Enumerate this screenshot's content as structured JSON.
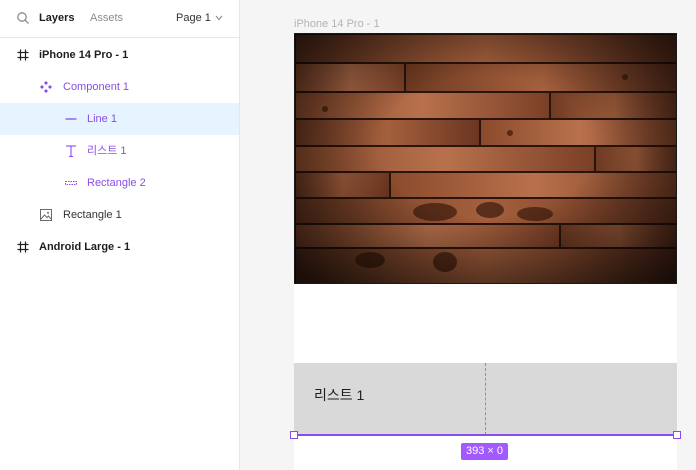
{
  "sidebar": {
    "tabs": {
      "layers": "Layers",
      "assets": "Assets"
    },
    "page": "Page 1",
    "layers": [
      {
        "label": "iPhone 14 Pro - 1",
        "icon": "frame-icon",
        "indent": 0,
        "style": "bold"
      },
      {
        "label": "Component 1",
        "icon": "component-icon",
        "indent": 1,
        "style": "purple"
      },
      {
        "label": "Line 1",
        "icon": "line-icon",
        "indent": 2,
        "style": "purple",
        "selected": true
      },
      {
        "label": "리스트 1",
        "icon": "text-icon",
        "indent": 2,
        "style": "purple"
      },
      {
        "label": "Rectangle 2",
        "icon": "rectangle-icon",
        "indent": 2,
        "style": "purple"
      },
      {
        "label": "Rectangle 1",
        "icon": "image-icon",
        "indent": 1,
        "style": "dark"
      },
      {
        "label": "Android Large - 1",
        "icon": "frame-icon",
        "indent": 0,
        "style": "bold"
      }
    ]
  },
  "canvas": {
    "frame_title": "iPhone 14 Pro - 1",
    "list_label": "리스트 1",
    "size_badge": "393 × 0"
  },
  "colors": {
    "accent": "#8a4de8",
    "selection_bg": "#e5f4ff",
    "badge": "#a259ff",
    "list_bg": "#d9d9d9"
  }
}
